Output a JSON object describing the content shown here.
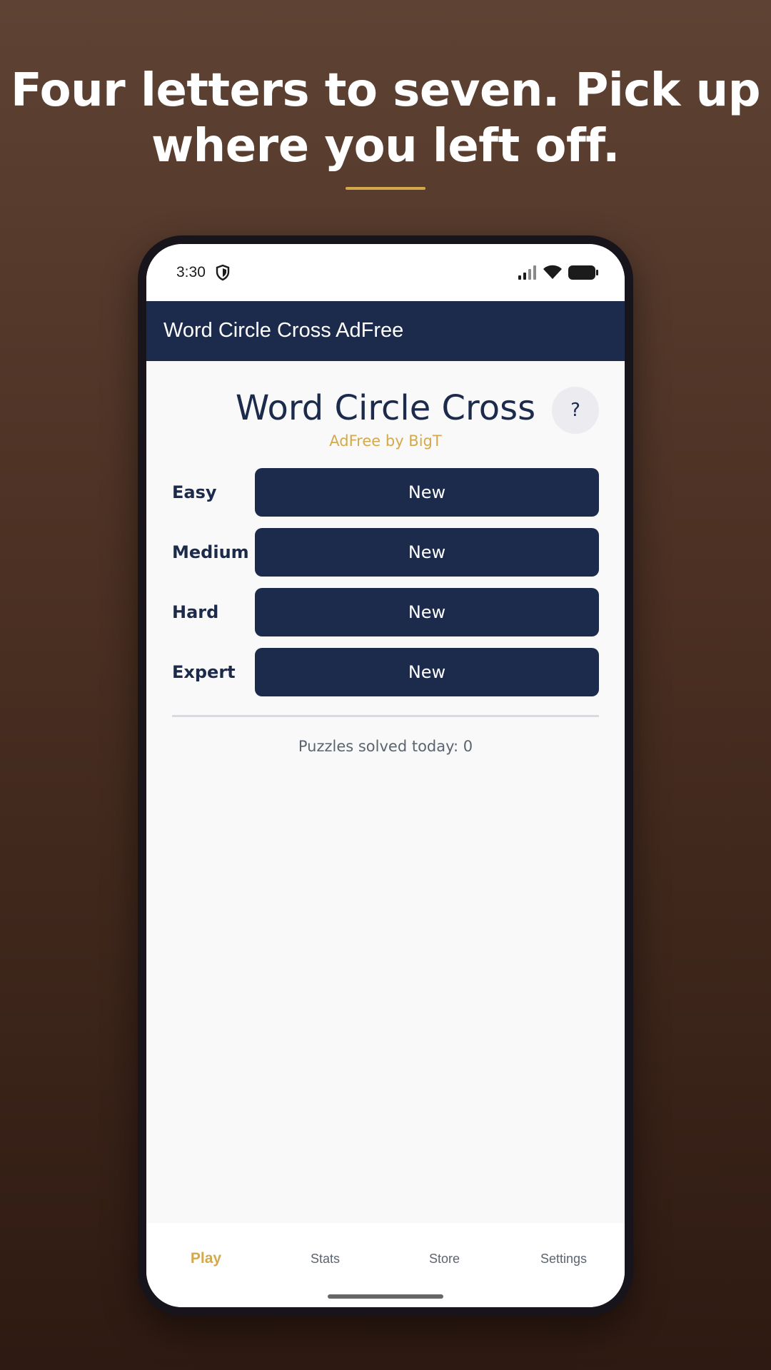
{
  "headline": "Four letters to seven. Pick up where you left off.",
  "status_bar": {
    "time": "3:30"
  },
  "app_bar": {
    "title": "Word Circle Cross AdFree"
  },
  "home": {
    "title": "Word Circle Cross",
    "subtitle": "AdFree by BigT",
    "help_label": "?",
    "difficulties": [
      {
        "label": "Easy",
        "button": "New"
      },
      {
        "label": "Medium",
        "button": "New"
      },
      {
        "label": "Hard",
        "button": "New"
      },
      {
        "label": "Expert",
        "button": "New"
      }
    ],
    "solved_text": "Puzzles solved today: 0"
  },
  "bottom_nav": {
    "items": [
      {
        "label": "Play",
        "active": true
      },
      {
        "label": "Stats",
        "active": false
      },
      {
        "label": "Store",
        "active": false
      },
      {
        "label": "Settings",
        "active": false
      }
    ]
  },
  "colors": {
    "primary": "#1c2a4c",
    "accent": "#d4a94a",
    "background_top": "#5e4233",
    "background_bottom": "#2e1a12"
  }
}
